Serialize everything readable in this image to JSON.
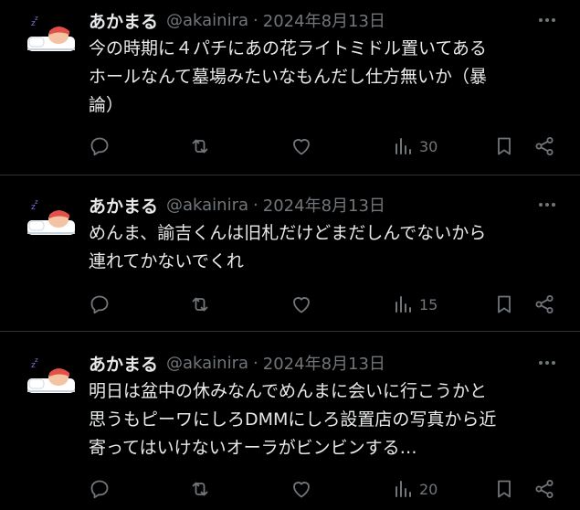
{
  "tweets": [
    {
      "author": "あかまる",
      "handle": "@akainira",
      "separator": "·",
      "date": "2024年8月13日",
      "text": "今の時期に４パチにあの花ライトミドル置いてある\nホールなんて墓場みたいなもんだし仕方無いか（暴\n論）",
      "views": "30"
    },
    {
      "author": "あかまる",
      "handle": "@akainira",
      "separator": "·",
      "date": "2024年8月13日",
      "text": "めんま、諭吉くんは旧札だけどまだしんでないから\n連れてかないでくれ",
      "views": "15"
    },
    {
      "author": "あかまる",
      "handle": "@akainira",
      "separator": "·",
      "date": "2024年8月13日",
      "text": "明日は盆中の休みなんでめんまに会いに行こうかと\n思うもピーワにしろDMMにしろ設置店の写真から近\n寄ってはいけないオーラがビンビンする…",
      "views": "20"
    }
  ],
  "icons": {
    "more": "more-horizontal-icon",
    "reply": "reply-bubble-icon",
    "retweet": "retweet-icon",
    "like": "heart-icon",
    "views": "bar-chart-icon",
    "bookmark": "bookmark-icon",
    "share": "share-icon"
  },
  "colors": {
    "background": "#000000",
    "text": "#e7e9ea",
    "secondary": "#71767b",
    "divider": "#2f3336"
  }
}
